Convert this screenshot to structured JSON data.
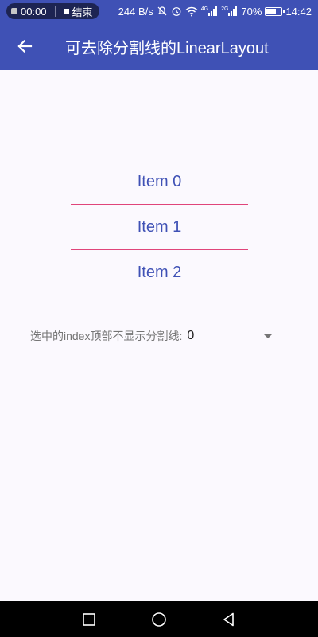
{
  "status_bar": {
    "record_time": "00:00",
    "record_action": "结束",
    "net_speed": "244 B/s",
    "signal_1_label": "4G",
    "signal_2_label": "2G",
    "battery": "70%",
    "battery_level": 0.7,
    "time": "14:42"
  },
  "app_bar": {
    "back_icon": "arrow-back-icon",
    "title": "可去除分割线的LinearLayout",
    "color": "#3f51b5"
  },
  "list": {
    "items": [
      "Item 0",
      "Item 1",
      "Item 2"
    ],
    "text_color": "#3f51b5",
    "divider_color": "#e0457a"
  },
  "spinner": {
    "label": "选中的index顶部不显示分割线:",
    "value": "0"
  },
  "nav_bar": {
    "recent_icon": "square-recent-icon",
    "home_icon": "circle-home-icon",
    "back_icon": "triangle-back-icon"
  }
}
